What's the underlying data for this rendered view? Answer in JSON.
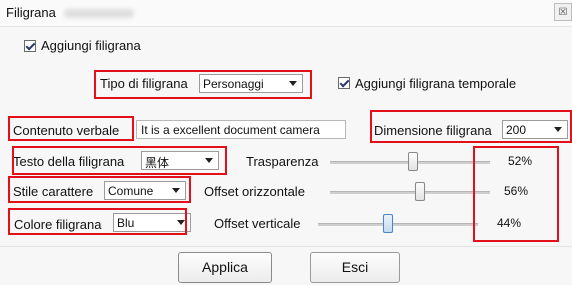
{
  "window": {
    "title": "Filigrana",
    "close_glyph": "☒"
  },
  "add_watermark": {
    "label": "Aggiungi filigrana",
    "checked": true
  },
  "type": {
    "label": "Tipo di filigrana",
    "value": "Personaggi"
  },
  "add_temporal": {
    "label": "Aggiungi filigrana temporale",
    "checked": true
  },
  "content": {
    "label": "Contenuto verbale",
    "value": "It is a excellent document camera"
  },
  "size": {
    "label": "Dimensione filigrana",
    "value": "200"
  },
  "font_text": {
    "label": "Testo della filigrana",
    "value": "黑体"
  },
  "style": {
    "label": "Stile carattere",
    "value": "Comune"
  },
  "color": {
    "label": "Colore filigrana",
    "value": "Blu"
  },
  "sliders": [
    {
      "label": "Trasparenza",
      "percent": 52,
      "display": "52%"
    },
    {
      "label": "Offset orizzontale",
      "percent": 56,
      "display": "56%"
    },
    {
      "label": "Offset verticale",
      "percent": 44,
      "display": "44%"
    }
  ],
  "buttons": {
    "apply": "Applica",
    "exit": "Esci"
  },
  "colors": {
    "highlight": "#e3101a",
    "accent": "#4a86c5"
  }
}
